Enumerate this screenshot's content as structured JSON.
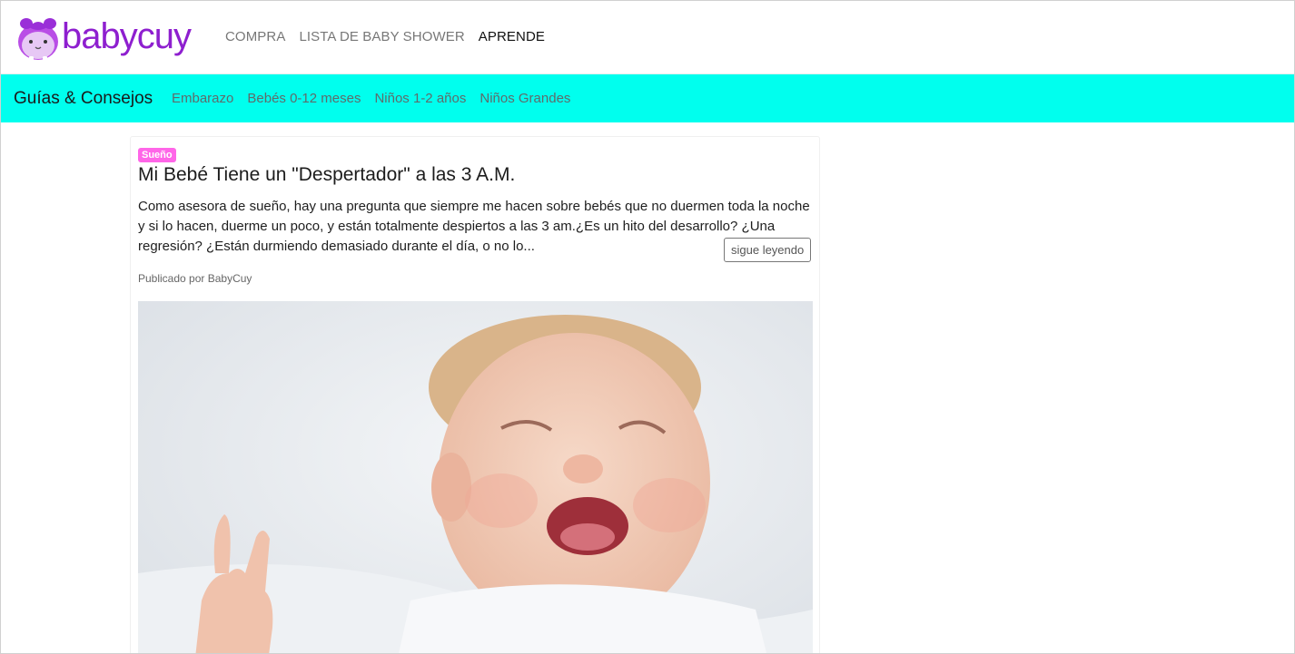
{
  "header": {
    "logo_text": "babycuy",
    "nav": [
      {
        "label": "COMPRA",
        "active": false
      },
      {
        "label": "LISTA DE BABY SHOWER",
        "active": false
      },
      {
        "label": "APRENDE",
        "active": true
      }
    ]
  },
  "subnav": {
    "brand": "Guías & Consejos",
    "items": [
      "Embarazo",
      "Bebés 0-12 meses",
      "Niños 1-2 años",
      "Niños Grandes"
    ],
    "background": "#00ffee"
  },
  "article": {
    "category": "Sueño",
    "title": "Mi Bebé Tiene un \"Despertador\" a las 3 A.M.",
    "excerpt": "Como asesora de sueño, hay una pregunta que siempre me hacen sobre bebés que no duermen toda la noche y si lo hacen, duerme un poco, y están totalmente despiertos a las 3 am.¿Es un hito del desarrollo? ¿Una regresión? ¿Están durmiendo demasiado durante el día, o no lo...",
    "read_more": "sigue leyendo",
    "author": "Publicado por BabyCuy",
    "badge_color": "#ff66e8"
  },
  "colors": {
    "brand_purple": "#8e1fcf",
    "accent_cyan": "#00ffee"
  }
}
